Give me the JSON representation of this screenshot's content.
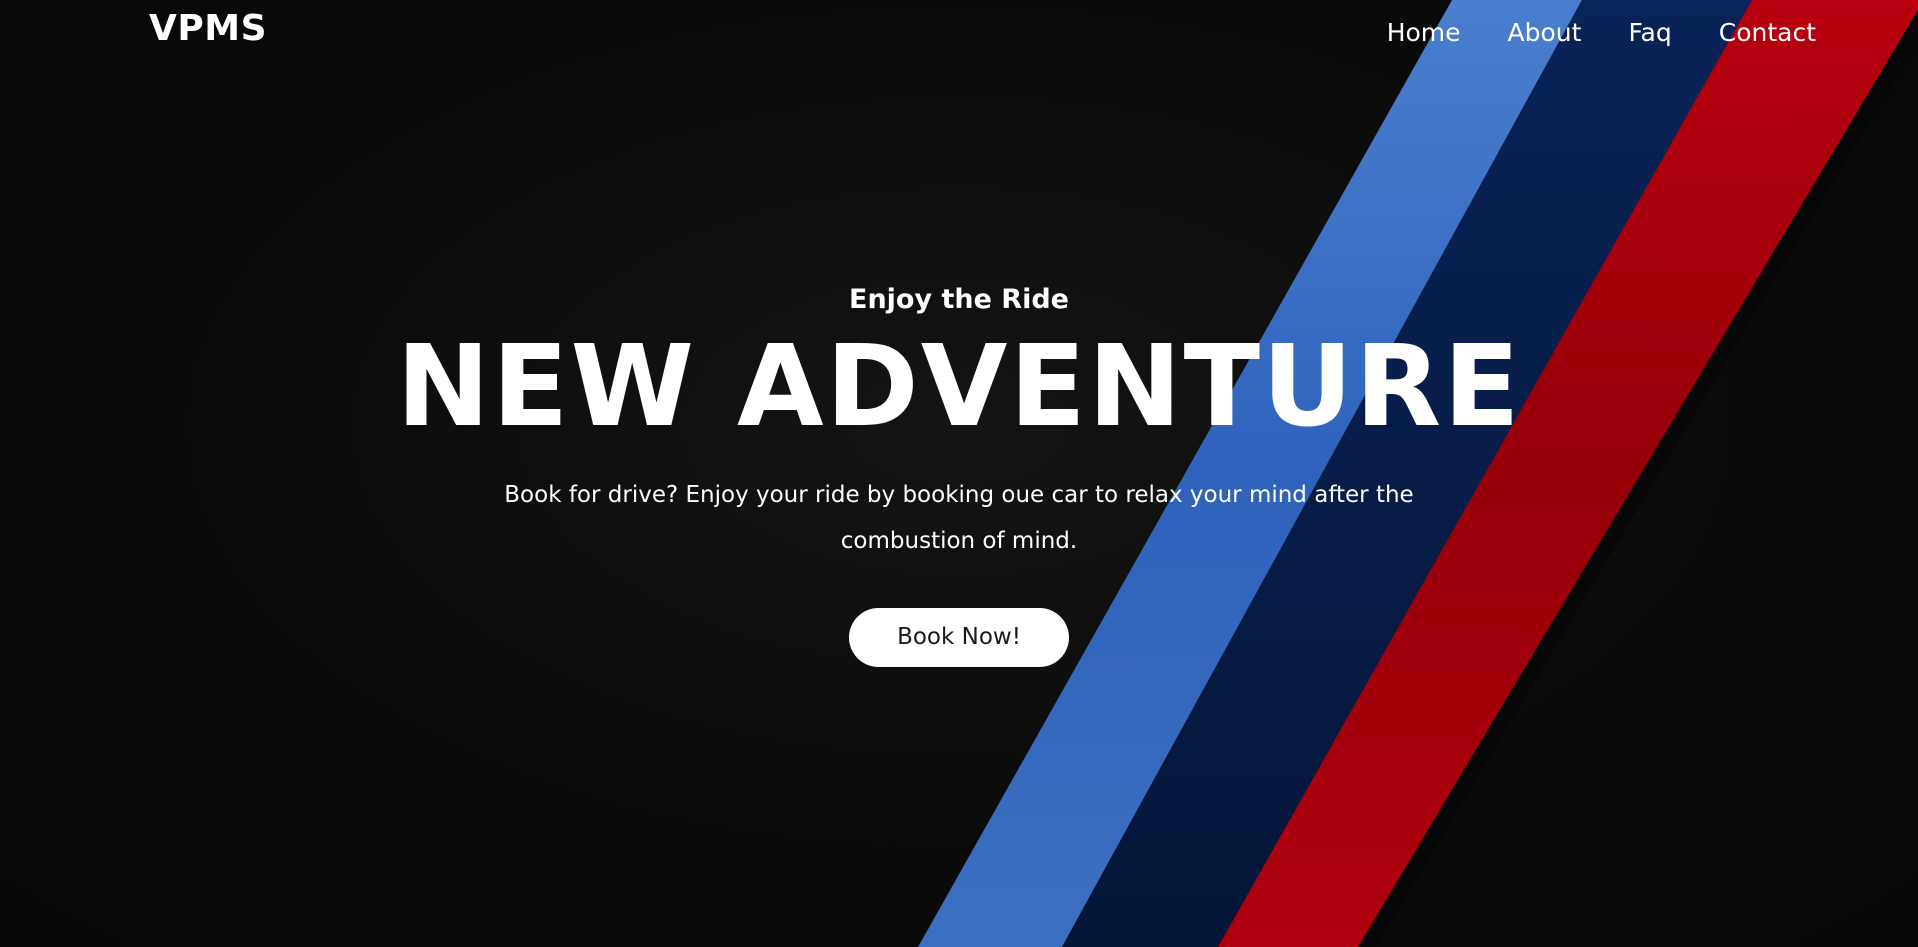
{
  "navbar": {
    "logo": "VPMS",
    "links": [
      {
        "label": "Home"
      },
      {
        "label": "About"
      },
      {
        "label": "Faq"
      },
      {
        "label": "Contact"
      }
    ]
  },
  "hero": {
    "tagline": "Enjoy the Ride",
    "headline": "NEW ADVENTURE",
    "description": "Book for drive? Enjoy your ride by booking oue car to relax your mind after the combustion of mind.",
    "cta_label": "Book Now!"
  },
  "colors": {
    "background": "#0b0b0b",
    "stripe_light_blue": "#3a6fc4",
    "stripe_dark_blue": "#06183f",
    "stripe_red": "#b3000f",
    "text": "#ffffff",
    "button_bg": "#ffffff",
    "button_text": "#1a1a1a"
  }
}
